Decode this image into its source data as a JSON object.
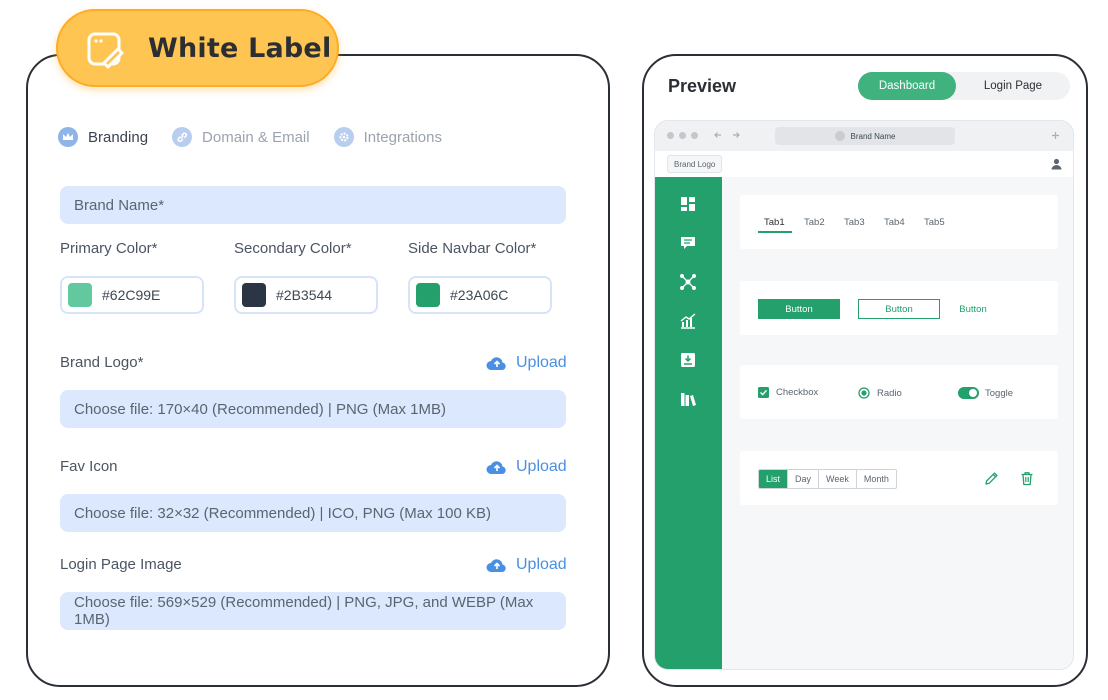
{
  "badge": {
    "title": "White Label"
  },
  "tabs": [
    {
      "label": "Branding"
    },
    {
      "label": "Domain & Email"
    },
    {
      "label": "Integrations"
    }
  ],
  "brand_name": {
    "placeholder": "Brand Name*"
  },
  "colors": {
    "primary": {
      "label": "Primary Color*",
      "value": "#62C99E"
    },
    "secondary": {
      "label": "Secondary Color*",
      "value": "#2B3544"
    },
    "navbar": {
      "label": "Side Navbar Color*",
      "value": "#23A06C"
    }
  },
  "uploads": {
    "logo": {
      "label": "Brand Logo*",
      "action": "Upload",
      "hint": "Choose file: 170×40 (Recommended) | PNG (Max 1MB)"
    },
    "fav": {
      "label": "Fav Icon",
      "action": "Upload",
      "hint": "Choose file: 32×32 (Recommended) | ICO, PNG (Max 100 KB)"
    },
    "login": {
      "label": "Login Page Image",
      "action": "Upload",
      "hint": "Choose file: 569×529 (Recommended) | PNG, JPG, and WEBP (Max 1MB)"
    }
  },
  "preview": {
    "title": "Preview",
    "toggle": [
      "Dashboard",
      "Login Page"
    ],
    "address": "Brand Name",
    "logo": "Brand Logo",
    "tabs": [
      "Tab1",
      "Tab2",
      "Tab3",
      "Tab4",
      "Tab5"
    ],
    "buttons": [
      "Button",
      "Button",
      "Button"
    ],
    "controls": {
      "checkbox": "Checkbox",
      "radio": "Radio",
      "toggle": "Toggle"
    },
    "views": [
      "List",
      "Day",
      "Week",
      "Month"
    ]
  },
  "accent": {
    "green": "#23A06C",
    "light_green": "#3FB27D",
    "blue": "#4A90E2",
    "badge": "#FFC552"
  }
}
